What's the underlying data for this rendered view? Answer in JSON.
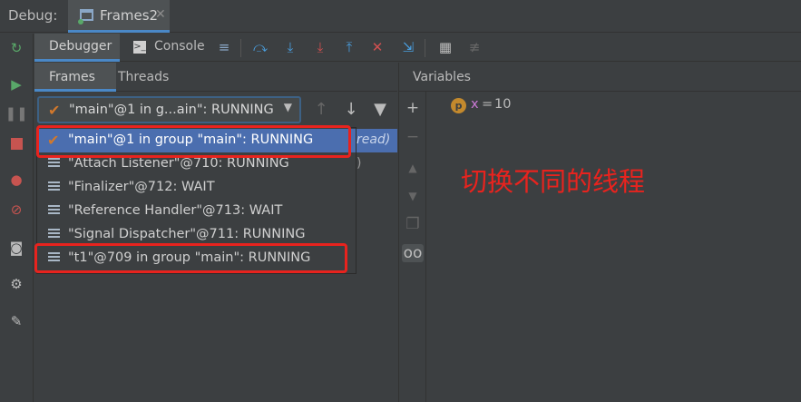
{
  "window": {
    "debug_label": "Debug:",
    "session_tab": "Frames2"
  },
  "toolbar": {
    "debugger_tab": "Debugger",
    "console_tab": "Console"
  },
  "frames_panel": {
    "frames_tab": "Frames",
    "threads_tab": "Threads",
    "selected_thread": "\"main\"@1 in g...ain\": RUNNING",
    "background_frame_fragment": "read)",
    "background_paren": ")"
  },
  "thread_list": [
    {
      "label": "\"main\"@1 in group \"main\": RUNNING",
      "selected": true,
      "icon": "check-icon"
    },
    {
      "label": "\"Attach Listener\"@710: RUNNING",
      "selected": false,
      "icon": "thread-icon"
    },
    {
      "label": "\"Finalizer\"@712: WAIT",
      "selected": false,
      "icon": "thread-icon"
    },
    {
      "label": "\"Reference Handler\"@713: WAIT",
      "selected": false,
      "icon": "thread-icon"
    },
    {
      "label": "\"Signal Dispatcher\"@711: RUNNING",
      "selected": false,
      "icon": "thread-icon"
    },
    {
      "label": "\"t1\"@709 in group \"main\": RUNNING",
      "selected": false,
      "icon": "thread-icon"
    }
  ],
  "variables_panel": {
    "header": "Variables",
    "items": [
      {
        "badge": "p",
        "name": "x",
        "eq": "=",
        "value": "10"
      }
    ]
  },
  "annotation": "切换不同的线程",
  "colors": {
    "accent": "#4a88c7",
    "selection": "#4b6eaf",
    "highlight": "#e8231e",
    "check": "#d1782c"
  }
}
